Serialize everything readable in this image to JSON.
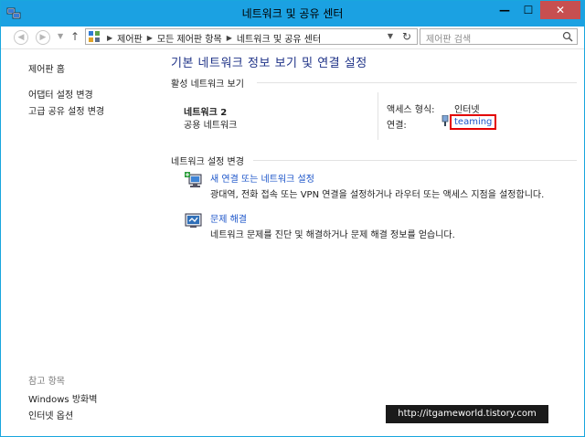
{
  "window": {
    "title": "네트워크 및 공유 센터",
    "buttons": {
      "minimize": "—",
      "maximize": "☐",
      "close": "✕"
    }
  },
  "address": {
    "breadcrumbs": [
      "제어판",
      "모든 제어판 항목",
      "네트워크 및 공유 센터"
    ],
    "search_placeholder": "제어판 검색"
  },
  "sidebar": {
    "home": "제어판 홈",
    "links": [
      "어댑터 설정 변경",
      "고급 공유 설정 변경"
    ],
    "see_also_label": "참고 항목",
    "see_also": [
      "Windows 방화벽",
      "인터넷 옵션"
    ]
  },
  "main": {
    "heading": "기본 네트워크 정보 보기 및 연결 설정",
    "active_section": "활성 네트워크 보기",
    "network": {
      "name": "네트워크 2",
      "type": "공용 네트워크",
      "access_label": "액세스 형식:",
      "access_value": "인터넷",
      "connection_label": "연결:",
      "connection_value": "teaming"
    },
    "change_section": "네트워크 설정 변경",
    "tasks": [
      {
        "title": "새 연결 또는 네트워크 설정",
        "desc": "광대역, 전화 접속 또는 VPN 연결을 설정하거나 라우터 또는 액세스 지점을 설정합니다."
      },
      {
        "title": "문제 해결",
        "desc": "네트워크 문제를 진단 및 해결하거나 문제 해결 정보를 얻습니다."
      }
    ]
  },
  "watermark": "http://itgameworld.tistory.com",
  "colors": {
    "titlebar": "#1ba1e2",
    "link": "#1b54c9",
    "heading": "#1e3287",
    "highlight": "#e30000"
  }
}
